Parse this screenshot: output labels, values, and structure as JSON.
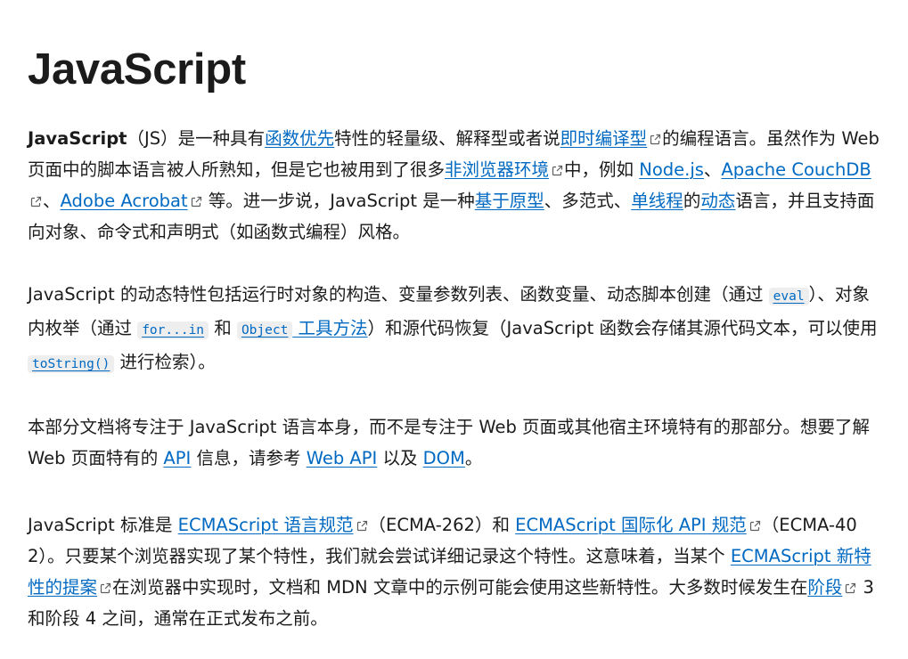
{
  "title": "JavaScript",
  "p1": {
    "s1": "JavaScript",
    "s2": "（JS）是一种具有",
    "l1": "函数优先",
    "s3": "特性的轻量级、解释型或者说",
    "l2": "即时编译型",
    "s4": "的编程语言。虽然作为 Web 页面中的脚本语言被人所熟知，但是它也被用到了很多",
    "l3": "非浏览器环境",
    "s5": "中，例如 ",
    "l4": "Node.js",
    "s6": "、",
    "l5": "Apache CouchDB",
    "s7": "、",
    "l6": "Adobe Acrobat",
    "s8": " 等。进一步说，JavaScript 是一种",
    "l7": "基于原型",
    "s9": "、多范式、",
    "l8": "单线程",
    "s10": "的",
    "l9": "动态",
    "s11": "语言，并且支持面向对象、命令式和声明式（如函数式编程）风格。"
  },
  "p2": {
    "s1": "JavaScript 的动态特性包括运行时对象的构造、变量参数列表、函数变量、动态脚本创建（通过 ",
    "c1": "eval",
    "s2": "）、对象内枚举（通过 ",
    "c2": "for...in",
    "s3": " 和 ",
    "c3": "Object",
    "l1": " 工具方法",
    "s4": "）和源代码恢复（JavaScript 函数会存储其源代码文本，可以使用 ",
    "c4": "toString()",
    "s5": " 进行检索）。"
  },
  "p3": {
    "s1": "本部分文档将专注于 JavaScript 语言本身，而不是专注于 Web 页面或其他宿主环境特有的那部分。想要了解 Web 页面特有的 ",
    "l1": "API",
    "s2": " 信息，请参考 ",
    "l2": "Web API",
    "s3": " 以及 ",
    "l3": "DOM",
    "s4": "。"
  },
  "p4": {
    "s1": "JavaScript 标准是 ",
    "l1": "ECMAScript 语言规范",
    "s2": "（ECMA-262）和 ",
    "l2": "ECMAScript 国际化 API 规范",
    "s3": "（ECMA-402）。只要某个浏览器实现了某个特性，我们就会尝试详细记录这个特性。这意味着，当某个 ",
    "l3": "ECMAScript 新特性的提案",
    "s4": "在浏览器中实现时，文档和 MDN 文章中的示例可能会使用这些新特性。大多数时候发生在",
    "l4": "阶段",
    "s5": " 3 和阶段 4 之间，通常在正式发布之前。"
  },
  "colors": {
    "text": "#1b1b1b",
    "link": "#0069c2",
    "code_bg": "#eeeeee"
  },
  "icons": {
    "external_link": "external-link-icon"
  }
}
